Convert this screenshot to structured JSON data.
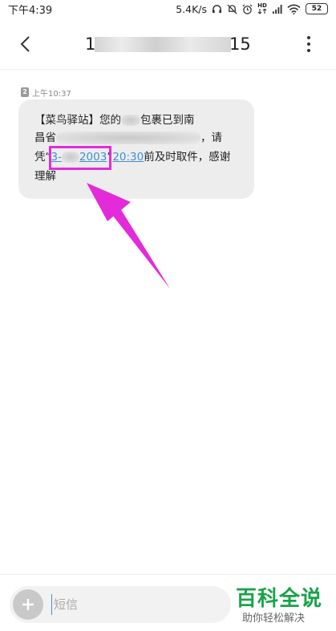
{
  "status": {
    "time": "下午4:39",
    "speed": "5.4K/s",
    "hd_label": "HD",
    "battery": "52"
  },
  "header": {
    "title_first": "1",
    "title_last": "15"
  },
  "message": {
    "sim_badge": "2",
    "time": "上午10:37",
    "line1_text": "【菜鸟驿站】您的",
    "line1_end": "包裹已到南",
    "line2_start": "昌",
    "line2_mid": "省",
    "line2_end": "，请",
    "line3_prefix": "凭“",
    "code_start": "3-",
    "code_end": "2003",
    "quote_close": "”",
    "time_link": "20:30",
    "line3_suffix": "前及时取件，感谢",
    "line4": "理解"
  },
  "input": {
    "placeholder": "短信"
  },
  "watermark": {
    "title": "百科全说",
    "subtitle": "助你轻松解决"
  },
  "colors": {
    "highlight": "#e32bd9",
    "link": "#3d8fd8",
    "watermark": "#19a34a"
  }
}
